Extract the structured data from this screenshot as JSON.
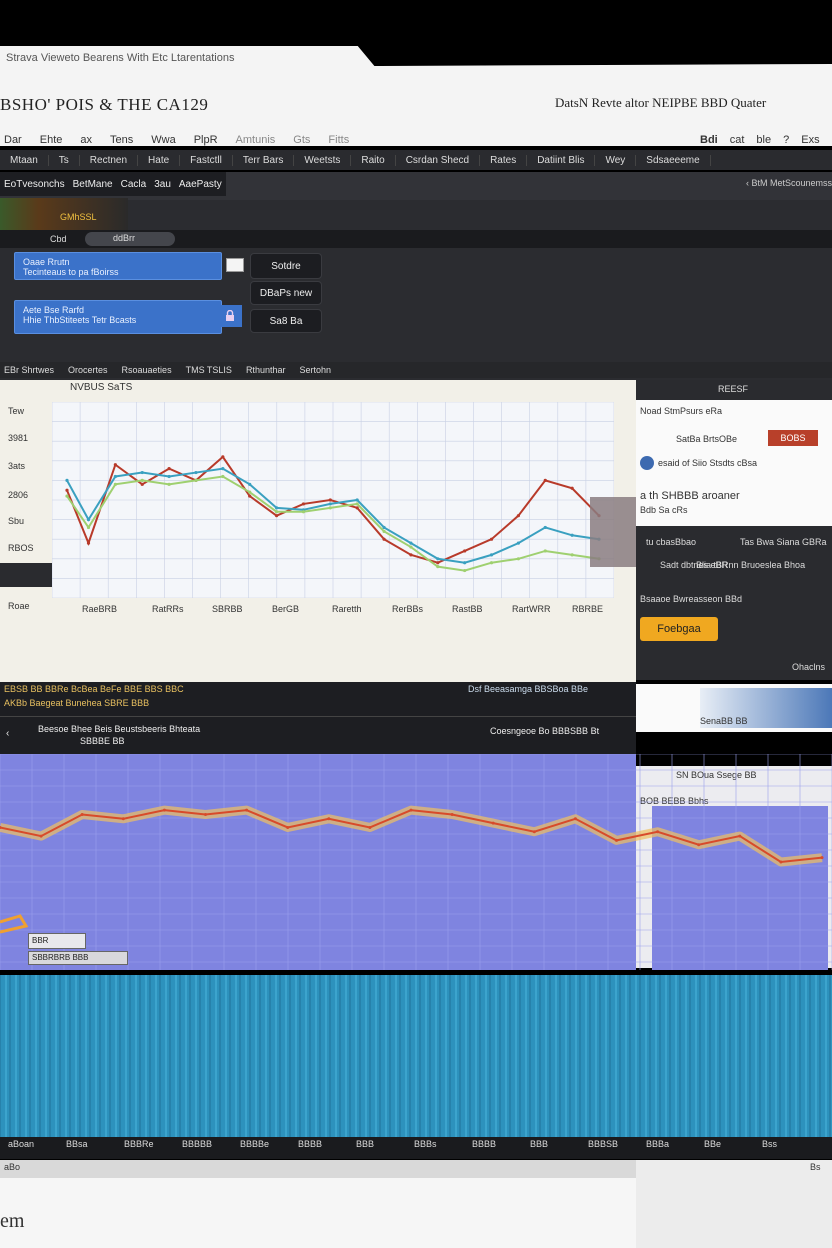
{
  "window": {
    "tab_title": "Strava Vieweto Bearens With Etc Ltarentations",
    "app_title": "BSHO' POIS & THE CA129",
    "right_title": "DatsN Revte altor NEIPBE BBD Quater"
  },
  "menu": {
    "items": [
      "Dar",
      "Ehte",
      "ax",
      "Tens",
      "Wwa",
      "PlpR",
      "Amtunis",
      "Gts",
      "Fitts"
    ],
    "right_items": [
      "Bdi",
      "cat",
      "ble",
      "?",
      "Exs"
    ]
  },
  "nav": {
    "items": [
      "Mtaan",
      "Ts",
      "Rectnen",
      "Hate",
      "Fastctll",
      "Terr Bars",
      "Weetsts",
      "Raito",
      "Csrdan Shecd",
      "Rates",
      "Datiint Blis",
      "Wey",
      "Sdsaeeeme"
    ]
  },
  "subnav": {
    "tabs": [
      "EoTvesonchs",
      "BetMane",
      "Cacla",
      "3au",
      "AaePasty"
    ],
    "right_text": "BtM MetScounemss"
  },
  "thumb": {
    "label": "GMhSSL"
  },
  "strip": {
    "left": "Cbd",
    "pill": "ddBrr"
  },
  "cards": [
    {
      "line1": "Oaae Rrutn",
      "line2": "Tecinteaus to pa fBoirss",
      "button": "Sotdre",
      "button2": "DBaPs new"
    },
    {
      "line1": "Aete Bse Rarfd",
      "line2": "Hhie ThbStiteets Tetr Bcasts",
      "button": "Sa8 Ba"
    }
  ],
  "tiny_bar": [
    "EBr Shrtwes",
    "Orocertes",
    "Rsoauaeties",
    "TMS TSLIS",
    "Rthunthar",
    "Sertohn"
  ],
  "chart1": {
    "header": "NVBUS SaTS",
    "right_label": "REESF",
    "y_ticks": [
      "Tew",
      "3981",
      "3ats",
      "2806",
      "Sbu",
      "RBOS",
      "Roae"
    ],
    "x_ticks": [
      "RaeBRB",
      "RatRRs",
      "SBRBB",
      "BerGB",
      "Raretth",
      "RerBBs",
      "RastBB",
      "RartWRR",
      "RBRBE"
    ]
  },
  "chart_data": [
    {
      "type": "line",
      "title": "",
      "xlabel": "",
      "ylabel": "",
      "x": [
        1,
        5,
        10,
        15,
        20,
        25,
        30,
        35,
        40,
        45,
        50,
        55,
        60,
        65,
        70,
        75,
        80,
        85,
        90,
        95,
        100
      ],
      "series": [
        {
          "values": [
            55,
            28,
            68,
            58,
            66,
            60,
            72,
            52,
            42,
            48,
            50,
            46,
            30,
            22,
            18,
            24,
            30,
            42,
            60,
            56,
            42
          ]
        },
        {
          "values": [
            60,
            40,
            62,
            64,
            62,
            64,
            66,
            58,
            46,
            45,
            48,
            50,
            36,
            28,
            20,
            18,
            22,
            28,
            36,
            32,
            30
          ]
        },
        {
          "values": [
            52,
            36,
            58,
            60,
            58,
            60,
            62,
            54,
            44,
            44,
            46,
            48,
            34,
            26,
            16,
            14,
            18,
            20,
            24,
            22,
            20
          ]
        }
      ],
      "ylim": [
        0,
        100
      ]
    },
    {
      "type": "line",
      "x": [
        0,
        5,
        10,
        15,
        20,
        25,
        30,
        35,
        40,
        45,
        50,
        55,
        60,
        65,
        70,
        75,
        80,
        85,
        90,
        95,
        100
      ],
      "series": [
        {
          "values": [
            66,
            62,
            72,
            70,
            74,
            72,
            74,
            66,
            70,
            66,
            74,
            72,
            68,
            64,
            70,
            60,
            64,
            58,
            62,
            50,
            52
          ]
        }
      ],
      "ylim": [
        0,
        100
      ]
    }
  ],
  "right_col": {
    "line1": "Noad StmPsurs eRa",
    "line2": "SatBa BrtsOBe",
    "button_label": "BOBS",
    "line3": "esaid of Siio Stsdts cBsa",
    "heading": "a th SHBBB aroaner",
    "sub": "Bdb Sa cRs",
    "d1": "tu cbasBbao",
    "d2": "Tas Bwa Siana GBRa",
    "d3": "Sadt dbtnes eBR",
    "d4": "Blia tBRnn Bruoeslea Bhoa",
    "d5": "Bsaaoe Bwreasseon BBd",
    "orange": "Foebgaa",
    "d6": "Ohaclns"
  },
  "mid": {
    "row1": "EBSB BB BBRe BcBea BeFe BBE BBS BBC",
    "row1_right": "Dsf Beeasamga BBSBoa BBe",
    "row2": "AKBb Baegeat Bunehea SBRE BBB",
    "row2_right": "",
    "title": "Beesoe Bhee Beis Beustsbeeris Bhteata",
    "subtitle": "SBBBE BB",
    "right": "Coesngeoe Bo BBBSBB Bt",
    "rc_line": "SenaBB BB",
    "rc2_1": "SN BOua Ssege BB",
    "rc2_2": "BOB BEBB Bbhs"
  },
  "chart2_legend": {
    "a": "BBR",
    "b": "SBBRBRB BBB"
  },
  "chart3_x": [
    "aBoan",
    "BBsa",
    "BBBRe",
    "BBBBB",
    "BBBBe",
    "BBBB",
    "BBB",
    "BBBs",
    "BBBB",
    "BBB",
    "BBBSB",
    "BBBa",
    "BBe",
    "Bss"
  ],
  "footer": {
    "logo": "em",
    "left_text": "aBo",
    "right_text": "Bs"
  }
}
